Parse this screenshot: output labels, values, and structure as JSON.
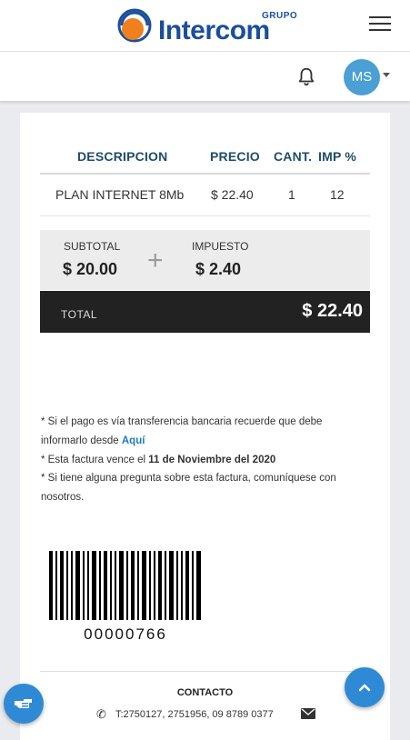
{
  "header": {
    "logo_grupo": "GRUPO",
    "logo_name": "Intercom",
    "user_initials": "MS"
  },
  "table": {
    "headers": [
      "DESCRIPCION",
      "PRECIO",
      "CANT.",
      "IMP %"
    ],
    "rows": [
      {
        "descripcion": "PLAN INTERNET 8Mb",
        "precio": "$ 22.40",
        "cant": "1",
        "imp": "12"
      }
    ]
  },
  "summary": {
    "subtotal_label": "SUBTOTAL",
    "subtotal_value": "$ 20.00",
    "plus_symbol": "+",
    "impuesto_label": "IMPUESTO",
    "impuesto_value": "$ 2.40",
    "total_label": "TOTAL",
    "total_value": "$ 22.40"
  },
  "notes": {
    "line1_text": "* Si el pago es vía transferencia bancaria recuerde que debe informarlo desde ",
    "line1_link": "Aquí",
    "line2_prefix": "* Esta factura vence el ",
    "line2_date": "11 de Noviembre del 2020",
    "line3_text": "* Si tiene alguna pregunta sobre esta factura, comuníquese con nosotros."
  },
  "barcode": {
    "number": "00000766"
  },
  "footer": {
    "contacto_label": "CONTACTO",
    "phone_text": "T:2750127, 2751956, 09 8789 0377"
  },
  "colors": {
    "brand_blue": "#1b4f9c",
    "brand_orange": "#f07f1e",
    "accent": "#2f8ad6",
    "header_text": "#1e4e66",
    "total_bg": "#222222"
  }
}
